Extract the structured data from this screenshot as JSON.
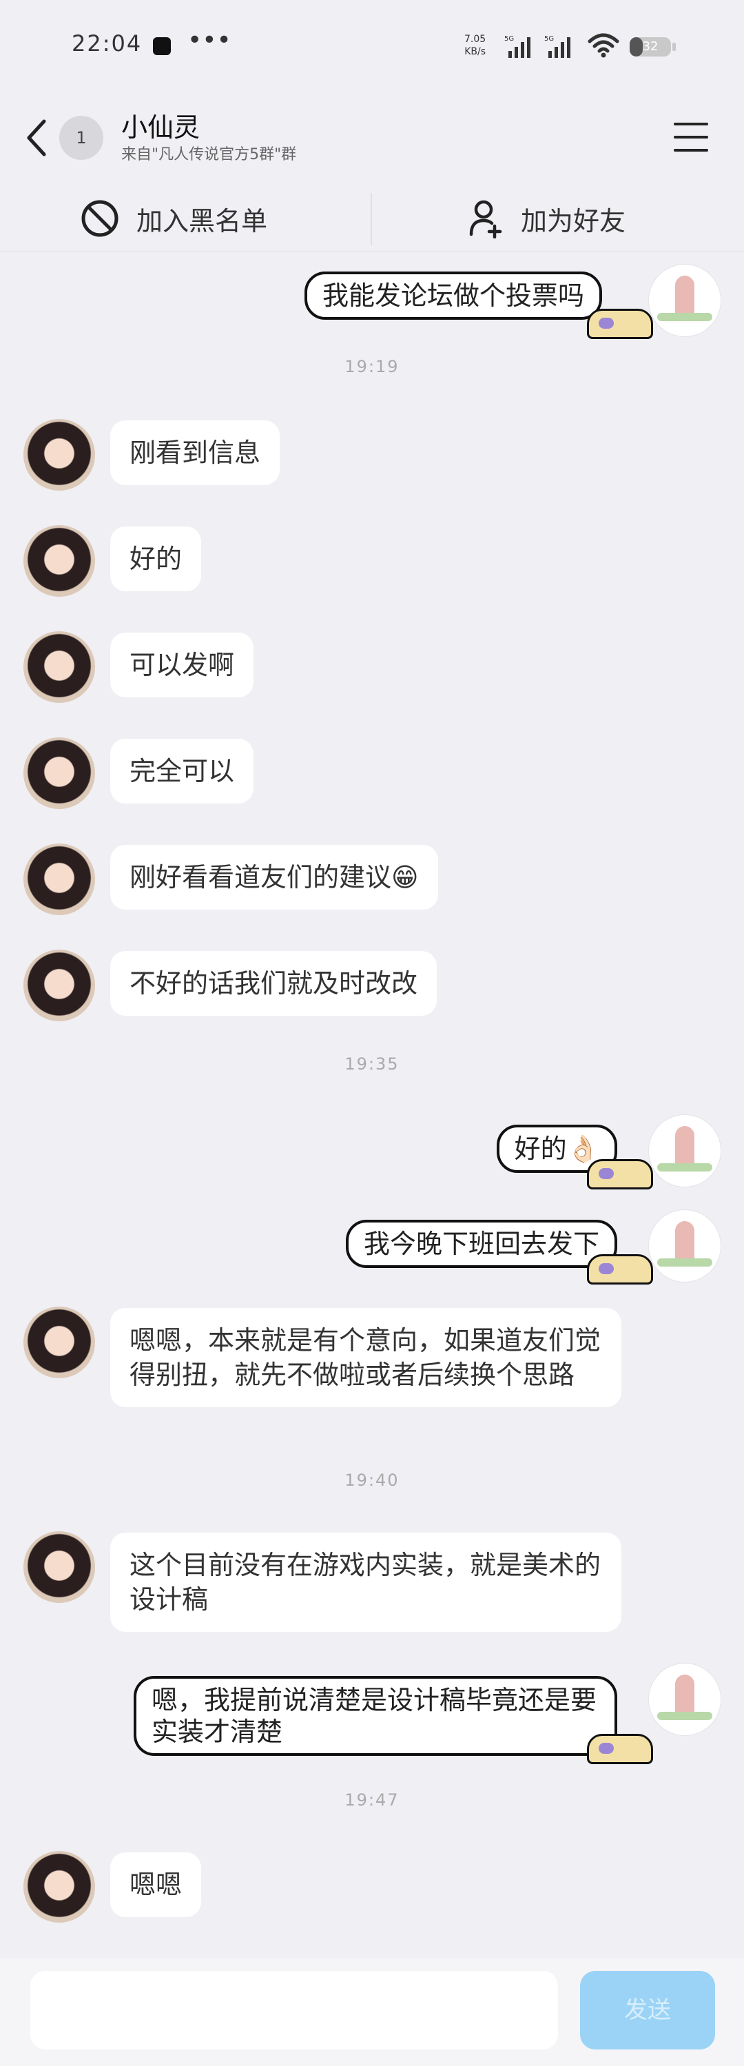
{
  "status_bar": {
    "time": "22:04",
    "more": "•••",
    "net_speed_value": "7.05",
    "net_speed_unit": "KB/s",
    "battery": "32",
    "battery_level": 0.32,
    "network1": "5G",
    "network2": "5G"
  },
  "header": {
    "unread_count": "1",
    "title": "小仙灵",
    "subtitle": "来自\"凡人传说官方5群\"群"
  },
  "actions": {
    "blacklist_label": "加入黑名单",
    "add_friend_label": "加为好友"
  },
  "messages": [
    {
      "side": "out",
      "text": "我能发论坛做个投票吗"
    },
    {
      "time": "19:19"
    },
    {
      "side": "in",
      "text": "刚看到信息"
    },
    {
      "side": "in",
      "text": "好的"
    },
    {
      "side": "in",
      "text": "可以发啊"
    },
    {
      "side": "in",
      "text": "完全可以"
    },
    {
      "side": "in",
      "text": "刚好看看道友们的建议😁"
    },
    {
      "side": "in",
      "text": "不好的话我们就及时改改"
    },
    {
      "time": "19:35"
    },
    {
      "side": "out",
      "text": "好的👌🏻"
    },
    {
      "side": "out",
      "text": "我今晚下班回去发下"
    },
    {
      "side": "in",
      "text": "嗯嗯，本来就是有个意向，如果道友们觉得别扭，就先不做啦或者后续换个思路"
    },
    {
      "time": "19:40"
    },
    {
      "side": "in",
      "text": "这个目前没有在游戏内实装，就是美术的设计稿"
    },
    {
      "side": "out",
      "text": "嗯，我提前说清楚是设计稿毕竟还是要实装才清楚"
    },
    {
      "time": "19:47"
    },
    {
      "side": "in",
      "text": "嗯嗯"
    }
  ],
  "composer": {
    "placeholder": "",
    "send_label": "发送"
  }
}
